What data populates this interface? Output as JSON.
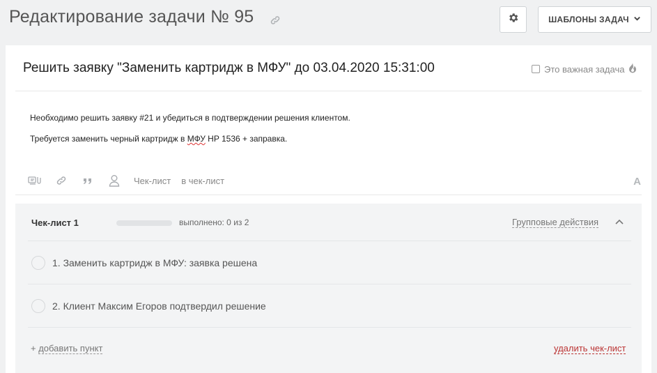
{
  "header": {
    "title": "Редактирование задачи № 95",
    "templates_button": "ШАБЛОНЫ ЗАДАЧ",
    "icons": [
      "link-icon",
      "gear-icon",
      "chevron-down-icon"
    ]
  },
  "task": {
    "title": "Решить заявку \"Заменить картридж в МФУ\" до 03.04.2020 15:31:00",
    "important_label": "Это важная задача",
    "important_checked": false,
    "description": {
      "line1": "Необходимо решить заявку #21 и убедиться в подтверждении решения клиентом.",
      "line2_prefix": "Требуется заменить черный картридж в ",
      "line2_mark": "МФУ",
      "line2_suffix": " HP 1536 + заправка."
    }
  },
  "toolbar": {
    "checklist": "Чек-лист",
    "to_checklist": "в чек-лист",
    "font_icon": "A",
    "icons": [
      "attachment-icon",
      "link-icon",
      "quote-icon",
      "user-icon",
      "font-icon"
    ]
  },
  "checklist": {
    "title": "Чек-лист 1",
    "progress_text": "выполнено: 0 из 2",
    "progress_fraction": 0,
    "group_actions": "Групповые действия",
    "items": [
      {
        "label": "1. Заменить картридж в МФУ: заявка решена",
        "done": false
      },
      {
        "label": "2. Клиент Максим Егоров подтвердил решение",
        "done": false
      }
    ],
    "add_prefix": "+ ",
    "add_item": "добавить пункт",
    "delete": "удалить чек-лист"
  },
  "colors": {
    "background": "#f0f1f2",
    "card": "#ffffff",
    "checklist_bg": "#f3f4f5",
    "delete_link": "#b33333"
  }
}
